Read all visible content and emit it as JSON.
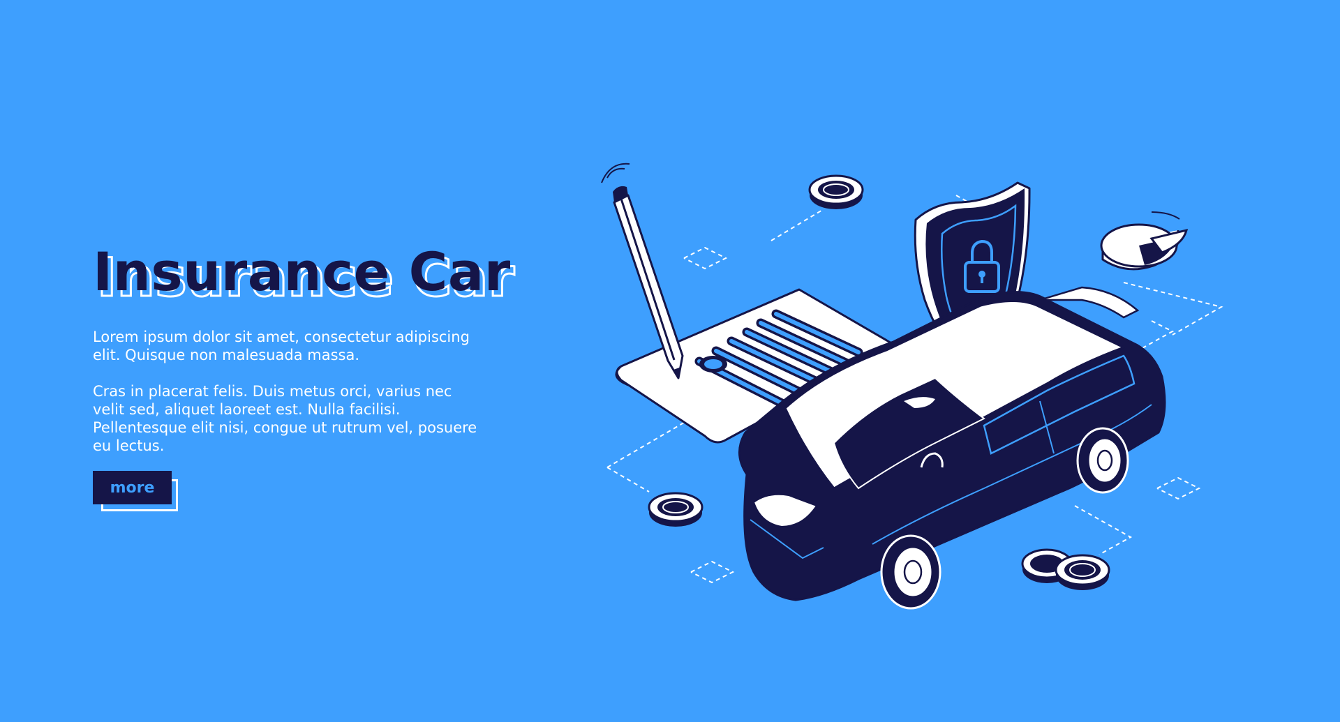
{
  "hero": {
    "title": "Insurance Car",
    "paragraph_1": "Lorem ipsum dolor sit amet, consectetur adipiscing elit. Quisque non malesuada massa.",
    "paragraph_2": "Cras in placerat felis. Duis metus orci, varius nec velit sed, aliquet laoreet est. Nulla facilisi. Pellentesque elit nisi, congue ut rutrum vel, posuere eu lectus.",
    "more_label": "more"
  },
  "colors": {
    "background": "#3e9ffe",
    "ink": "#151548",
    "white": "#ffffff"
  },
  "icons": [
    "pencil-icon",
    "document-icon",
    "shield-lock-icon",
    "car-icon",
    "coin-icon",
    "pie-chart-icon"
  ]
}
